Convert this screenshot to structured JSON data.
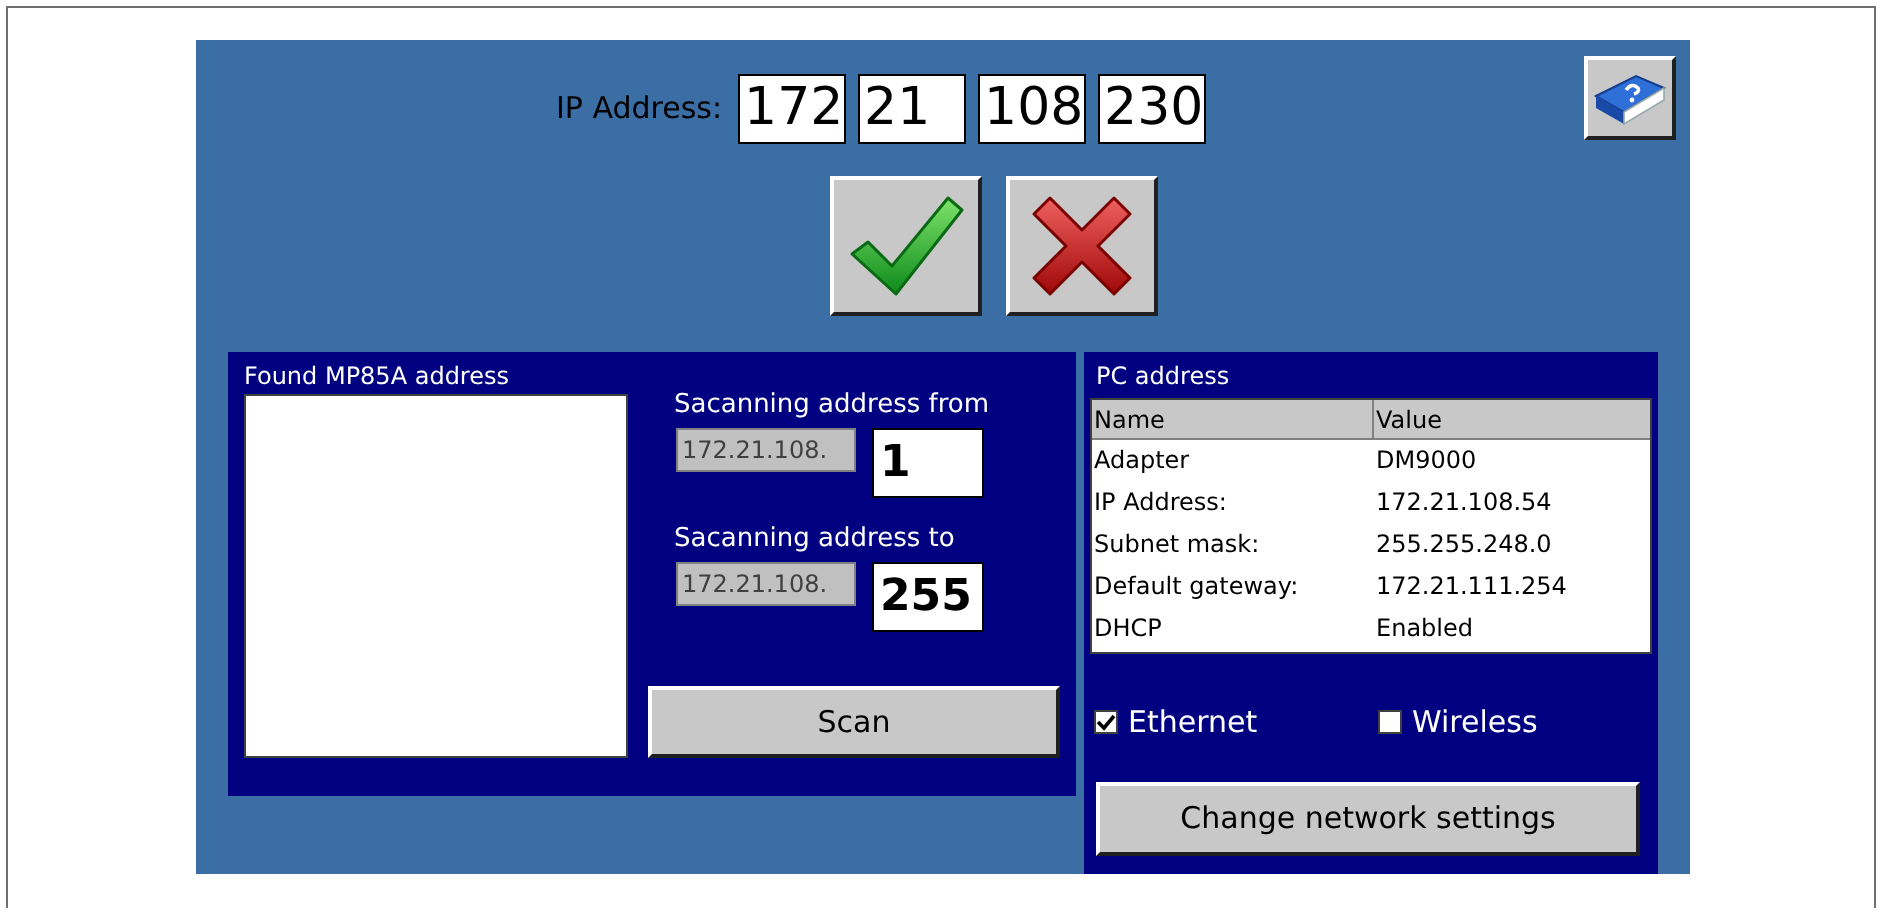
{
  "ip_address": {
    "label": "IP Address:",
    "octets": [
      "172",
      "21",
      "108",
      "230"
    ]
  },
  "actions": [
    {
      "kind": "confirm"
    },
    {
      "kind": "cancel"
    }
  ],
  "found_panel": {
    "title": "Found MP85A address"
  },
  "scan": {
    "from_label": "Sacanning address from",
    "from_prefix": "172.21.108.",
    "from_value": "1",
    "to_label": "Sacanning address to",
    "to_prefix": "172.21.108.",
    "to_value": "255",
    "button": "Scan"
  },
  "pc_panel": {
    "title": "PC address",
    "columns": [
      "Name",
      "Value"
    ],
    "rows": [
      [
        "Adapter",
        "DM9000"
      ],
      [
        "IP Address:",
        "172.21.108.54"
      ],
      [
        "Subnet mask:",
        "255.255.248.0"
      ],
      [
        "Default gateway:",
        "172.21.111.254"
      ],
      [
        "DHCP",
        "Enabled"
      ]
    ],
    "checkboxes": [
      {
        "label": "Ethernet",
        "checked": true
      },
      {
        "label": "Wireless",
        "checked": false
      }
    ],
    "button": "Change network settings"
  }
}
